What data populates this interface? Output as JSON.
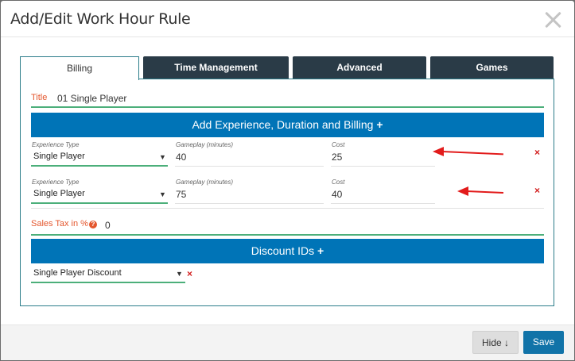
{
  "modal": {
    "title": "Add/Edit Work Hour Rule"
  },
  "tabs": [
    {
      "label": "Billing",
      "active": true
    },
    {
      "label": "Time Management",
      "active": false
    },
    {
      "label": "Advanced",
      "active": false
    },
    {
      "label": "Games",
      "active": false
    }
  ],
  "billing": {
    "title_label": "Title",
    "title_value": "01 Single Player",
    "add_experience_label": "Add Experience, Duration and Billing",
    "add_icon": "+",
    "rows": [
      {
        "experience_type_label": "Experience Type",
        "experience_type_value": "Single Player",
        "gameplay_label": "Gameplay (minutes)",
        "gameplay_value": "40",
        "cost_label": "Cost",
        "cost_value": "25"
      },
      {
        "experience_type_label": "Experience Type",
        "experience_type_value": "Single Player",
        "gameplay_label": "Gameplay (minutes)",
        "gameplay_value": "75",
        "cost_label": "Cost",
        "cost_value": "40"
      }
    ],
    "delete_icon": "×",
    "sales_tax_label": "Sales Tax in %",
    "help_icon": "?",
    "sales_tax_value": "0",
    "discount_label": "Discount IDs",
    "discount_value": "Single Player Discount"
  },
  "footer": {
    "hide_label": "Hide ↓",
    "save_label": "Save"
  },
  "colors": {
    "primary_blue": "#0074b7",
    "dark_tab": "#2a3b47",
    "label_orange": "#e4572e",
    "delete_red": "#d32020",
    "arrow_red": "#e21b1b"
  }
}
